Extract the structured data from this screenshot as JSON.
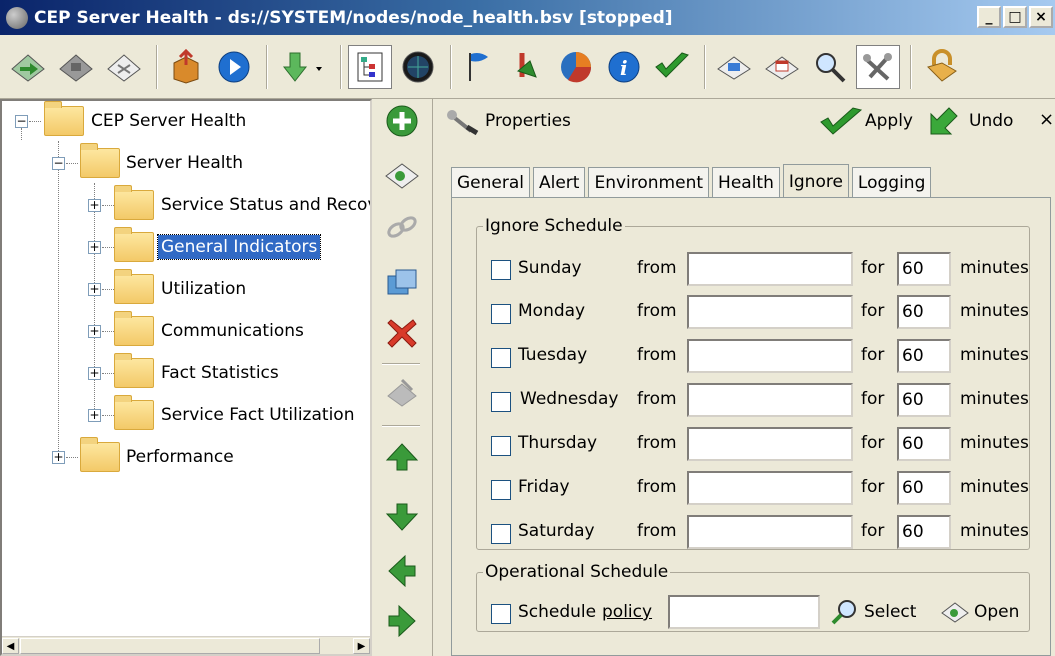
{
  "window": {
    "title": "CEP Server Health - ds://SYSTEM/nodes/node_health.bsv [stopped]",
    "controls": [
      "_",
      "□",
      "×"
    ]
  },
  "toolbar": {
    "icons": [
      "forward-icon",
      "save-icon",
      "clear-icon",
      "package-icon",
      "play-icon",
      "download-icon",
      "tree-view-icon",
      "globe-icon",
      "flag-icon",
      "tools-icon",
      "chart-icon",
      "info-icon",
      "check-icon",
      "book-icon",
      "calendar-icon",
      "search-icon",
      "wrench-icon",
      "lock-icon"
    ]
  },
  "tree": {
    "nodes": [
      {
        "label": "CEP Server Health",
        "level": 0,
        "expander": "−"
      },
      {
        "label": "Server Health",
        "level": 1,
        "expander": "−"
      },
      {
        "label": "Service Status and Recov",
        "level": 2,
        "expander": "+"
      },
      {
        "label": "General Indicators",
        "level": 2,
        "expander": "+",
        "selected": true
      },
      {
        "label": "Utilization",
        "level": 2,
        "expander": "+"
      },
      {
        "label": "Communications",
        "level": 2,
        "expander": "+"
      },
      {
        "label": "Fact Statistics",
        "level": 2,
        "expander": "+"
      },
      {
        "label": "Service Fact Utilization",
        "level": 2,
        "expander": "+"
      },
      {
        "label": "Performance",
        "level": 1,
        "expander": "+"
      }
    ]
  },
  "properties": {
    "header": "Properties",
    "apply_label": "Apply",
    "undo_label": "Undo",
    "close_label": "×",
    "tabs": [
      "General",
      "Alert",
      "Environment",
      "Health",
      "Ignore",
      "Logging"
    ],
    "active_tab": "Ignore",
    "ignore_schedule": {
      "legend": "Ignore Schedule",
      "from_label": "from",
      "for_label": "for",
      "minutes_label": "minutes",
      "days": [
        {
          "day": "Sunday",
          "from": "",
          "for": "60"
        },
        {
          "day": "Monday",
          "from": "",
          "for": "60"
        },
        {
          "day": "Tuesday",
          "from": "",
          "for": "60"
        },
        {
          "day": "Wednesday",
          "from": "",
          "for": "60"
        },
        {
          "day": "Thursday",
          "from": "",
          "for": "60"
        },
        {
          "day": "Friday",
          "from": "",
          "for": "60"
        },
        {
          "day": "Saturday",
          "from": "",
          "for": "60"
        }
      ]
    },
    "operational_schedule": {
      "legend": "Operational Schedule",
      "schedule_label": "Schedule",
      "policy_label": "policy",
      "policy_value": "",
      "select_label": "Select",
      "open_label": "Open"
    }
  },
  "colors": {
    "selection": "#316ac5",
    "title_gradient_start": "#0a246a",
    "title_gradient_end": "#a6caf0"
  }
}
